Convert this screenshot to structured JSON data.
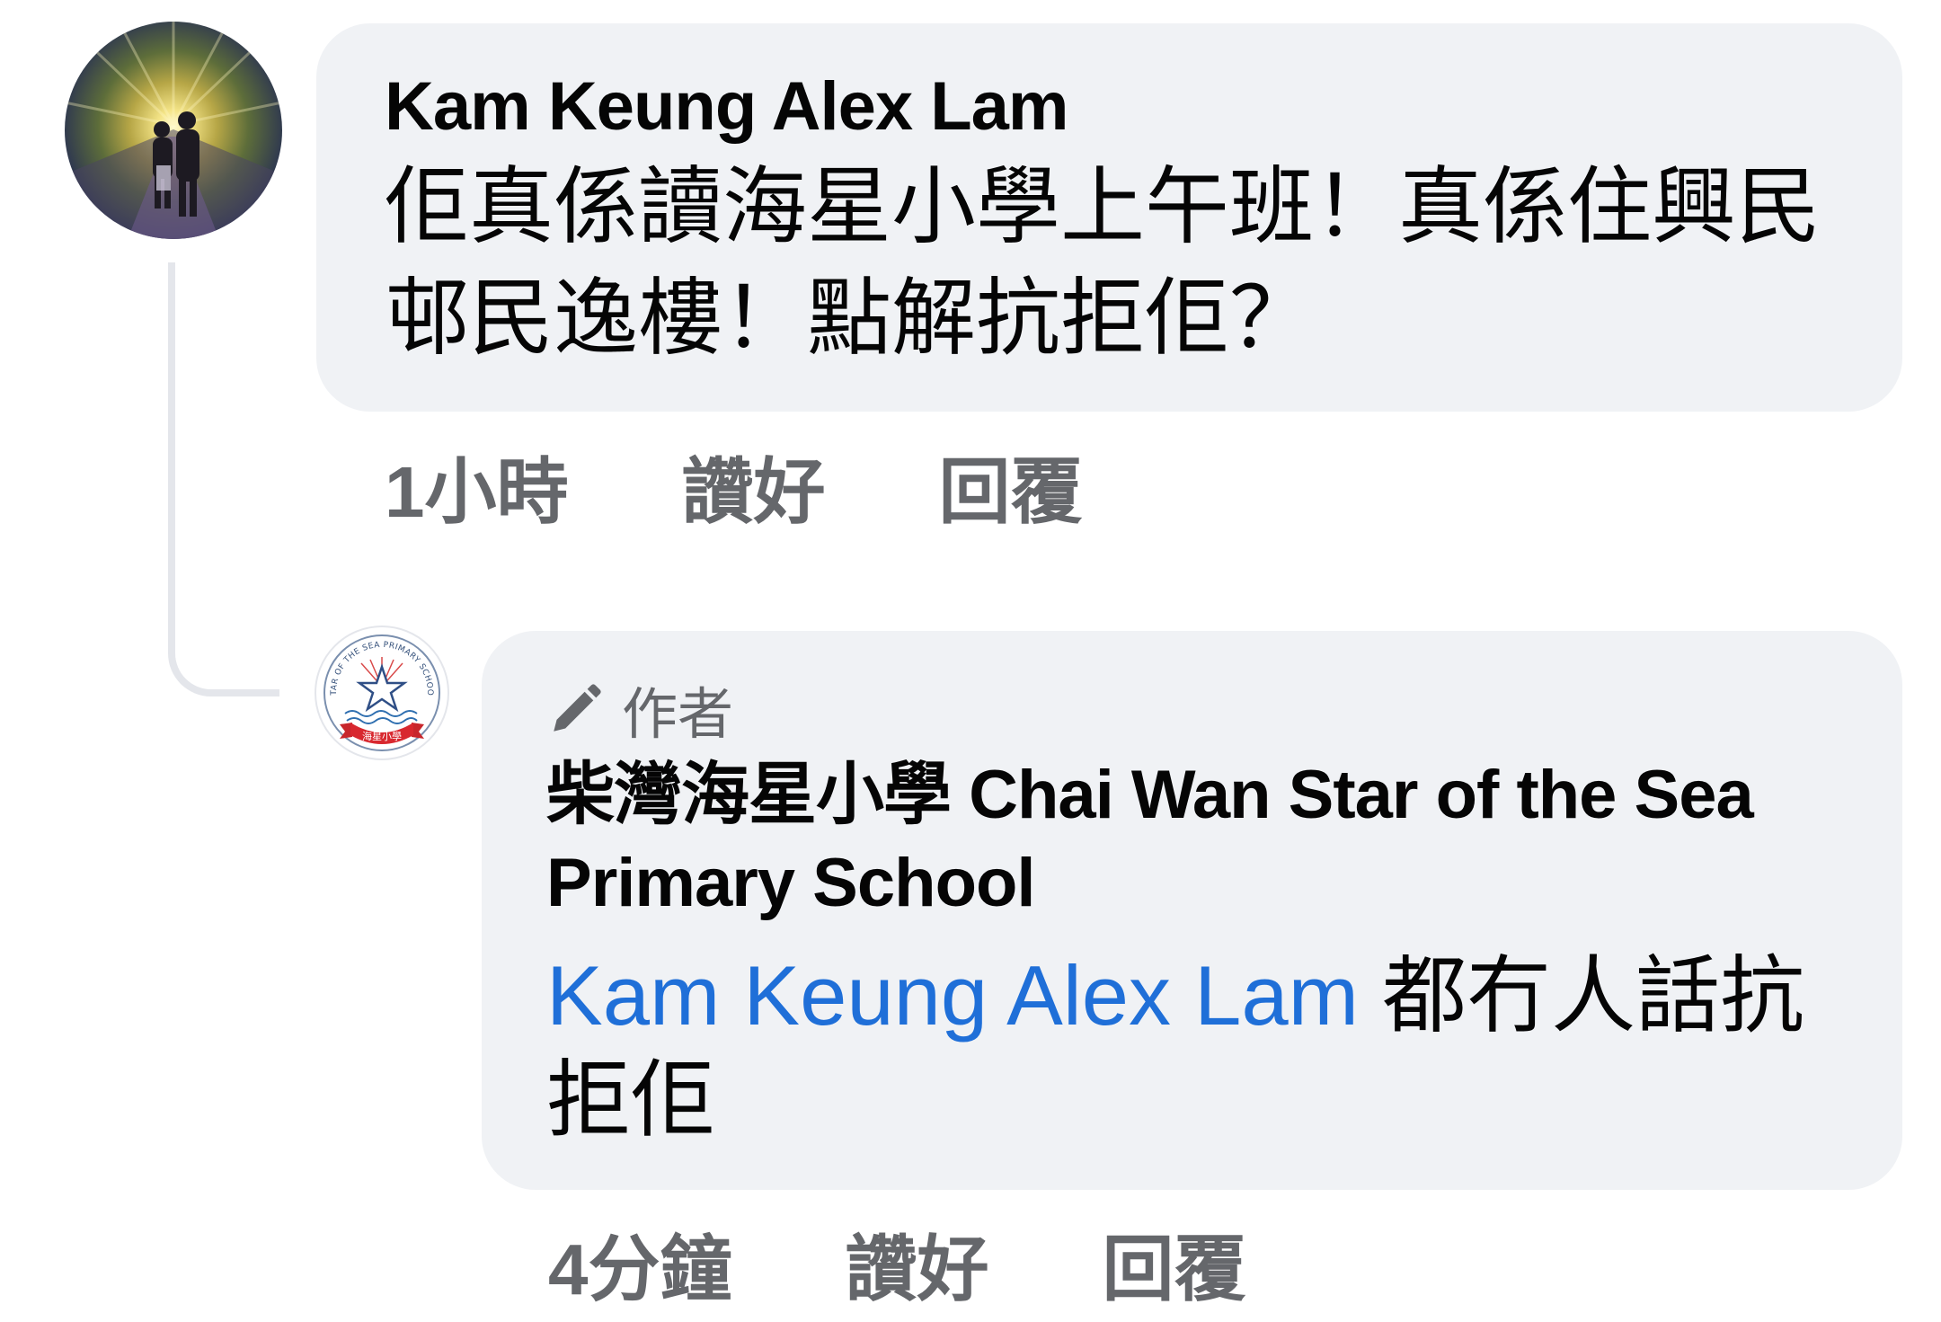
{
  "thread": {
    "comment": {
      "author": "Kam Keung Alex Lam",
      "text": "佢真係讀海星小學上午班！真係住興民邨民逸樓！點解抗拒佢？",
      "time": "1小時",
      "like_label": "讚好",
      "reply_label": "回覆"
    },
    "reply": {
      "badge_label": "作者",
      "author": "柴灣海星小學 Chai Wan Star of the Sea Primary School",
      "mention": "Kam Keung Alex Lam",
      "text": "都冇人話抗拒佢",
      "time": "4分鐘",
      "like_label": "讚好",
      "reply_label": "回覆",
      "logo_text": "STAR OF THE SEA PRIMARY SCHOOL",
      "logo_ribbon_text": "海星小學"
    }
  },
  "colors": {
    "bubble_bg": "#f0f2f5",
    "text_primary": "#050505",
    "text_secondary": "#65676b",
    "mention_link": "#1f6fd8",
    "thread_line": "#e4e6eb"
  },
  "icons": {
    "author_badge": "pen-icon"
  }
}
